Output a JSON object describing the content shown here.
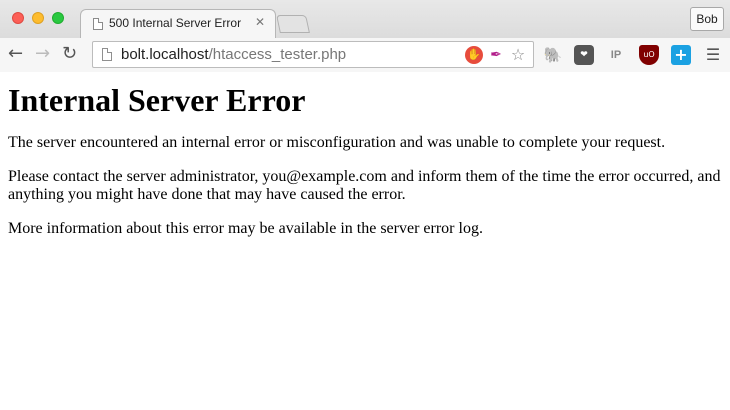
{
  "browser": {
    "tab": {
      "title": "500 Internal Server Error",
      "close_glyph": "✕"
    },
    "profile_button": "Bob",
    "nav": {
      "back_glyph": "←",
      "forward_glyph": "→",
      "reload_glyph": "↻"
    },
    "address": {
      "host": "bolt.localhost",
      "path": "/htaccess_tester.php"
    },
    "icons": {
      "omnibox": [
        "adblock-icon",
        "feather-icon",
        "bookmark-star-icon"
      ],
      "extensions": [
        "evernote-icon",
        "pocket-icon",
        "ip-icon",
        "ublock-icon",
        "plus-icon",
        "menu-icon"
      ]
    }
  },
  "page": {
    "heading": "Internal Server Error",
    "paragraphs": [
      "The server encountered an internal error or misconfiguration and was unable to complete your request.",
      "Please contact the server administrator, you@example.com and inform them of the time the error occurred, and anything you might have done that may have caused the error.",
      "More information about this error may be available in the server error log."
    ]
  },
  "colors": {
    "close": "#fc5f57",
    "minimize": "#fdbc2e",
    "maximize": "#29c840"
  }
}
